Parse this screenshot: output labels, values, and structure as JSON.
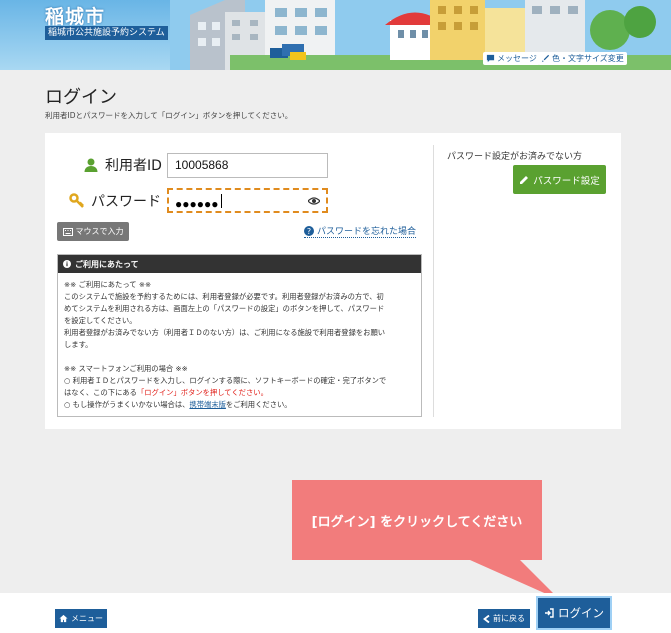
{
  "header": {
    "site_title": "稲城市",
    "site_subtitle": "稲城市公共施設予約システム",
    "message_label": "メッセージ",
    "display_label": "色・文字サイズ変更"
  },
  "page": {
    "title": "ログイン",
    "description": "利用者IDとパスワードを入力して「ログイン」ボタンを押してください。"
  },
  "form": {
    "user_id_label": "利用者ID",
    "user_id_value": "10005868",
    "password_label": "パスワード",
    "password_mask": "●●●●●●",
    "mouse_input_label": "マウスで入力",
    "forgot_label": "パスワードを忘れた場合"
  },
  "notice": {
    "heading": "ご利用にあたって",
    "s1_title": "※※ ご利用にあたって ※※",
    "s1_line1": "このシステムで施設を予約するためには、利用者登録が必要です。利用者登録がお済みの方で、初",
    "s1_line2": "めてシステムを利用される方は、画面左上の「パスワードの設定」のボタンを押して、パスワード",
    "s1_line3": "を設定してください。",
    "s1_line4": "利用者登録がお済みでない方（利用者ＩＤのない方）は、ご利用になる施設で利用者登録をお願い",
    "s1_line5": "します。",
    "s2_title": "※※ スマートフォンご利用の場合 ※※",
    "s2_line1": "○ 利用者ＩＤとパスワードを入力し、ログインする際に、ソフトキーボードの確定・完了ボタンで",
    "s2_line2a": "はなく、この下にある",
    "s2_line2b": "「ログイン」ボタンを押してください。",
    "s2_line3a": "○ もし操作がうまくいかない場合は、",
    "s2_line3b": "携帯端末版",
    "s2_line3c": "をご利用ください。"
  },
  "side": {
    "no_password_text": "パスワード設定がお済みでない方",
    "password_setting_label": "パスワード設定"
  },
  "callout": {
    "text": "[ログイン] をクリックしてください"
  },
  "footer": {
    "menu_label": "メニュー",
    "back_label": "前に戻る",
    "login_label": "ログイン"
  },
  "colors": {
    "primary": "#1e5e9a",
    "green": "#5aa130",
    "callout": "#f27c7c",
    "highlight": "#e08b1e",
    "alert": "#e1201a"
  }
}
